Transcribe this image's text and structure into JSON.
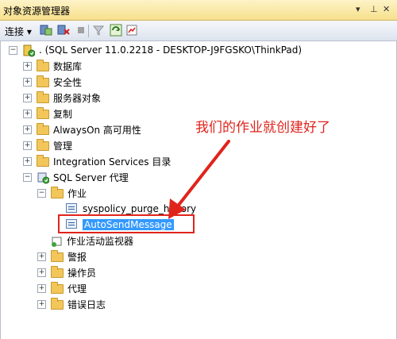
{
  "titlebar": {
    "title": "对象资源管理器",
    "pin": "▾ ‡ ×"
  },
  "toolbar": {
    "connect_label": "连接 ▾"
  },
  "tree": {
    "root": ". (SQL Server 11.0.2218 - DESKTOP-J9FGSKO\\ThinkPad)",
    "items": [
      "数据库",
      "安全性",
      "服务器对象",
      "复制",
      "AlwaysOn 高可用性",
      "管理",
      "Integration Services 目录",
      "SQL Server 代理"
    ],
    "agent": {
      "jobs_folder": "作业",
      "jobs": [
        "syspolicy_purge_history",
        "AutoSendMessage"
      ],
      "activity_monitor": "作业活动监视器",
      "children": [
        "警报",
        "操作员",
        "代理",
        "错误日志"
      ]
    }
  },
  "annotation": {
    "text": "我们的作业就创建好了",
    "color": "#e0241c"
  }
}
